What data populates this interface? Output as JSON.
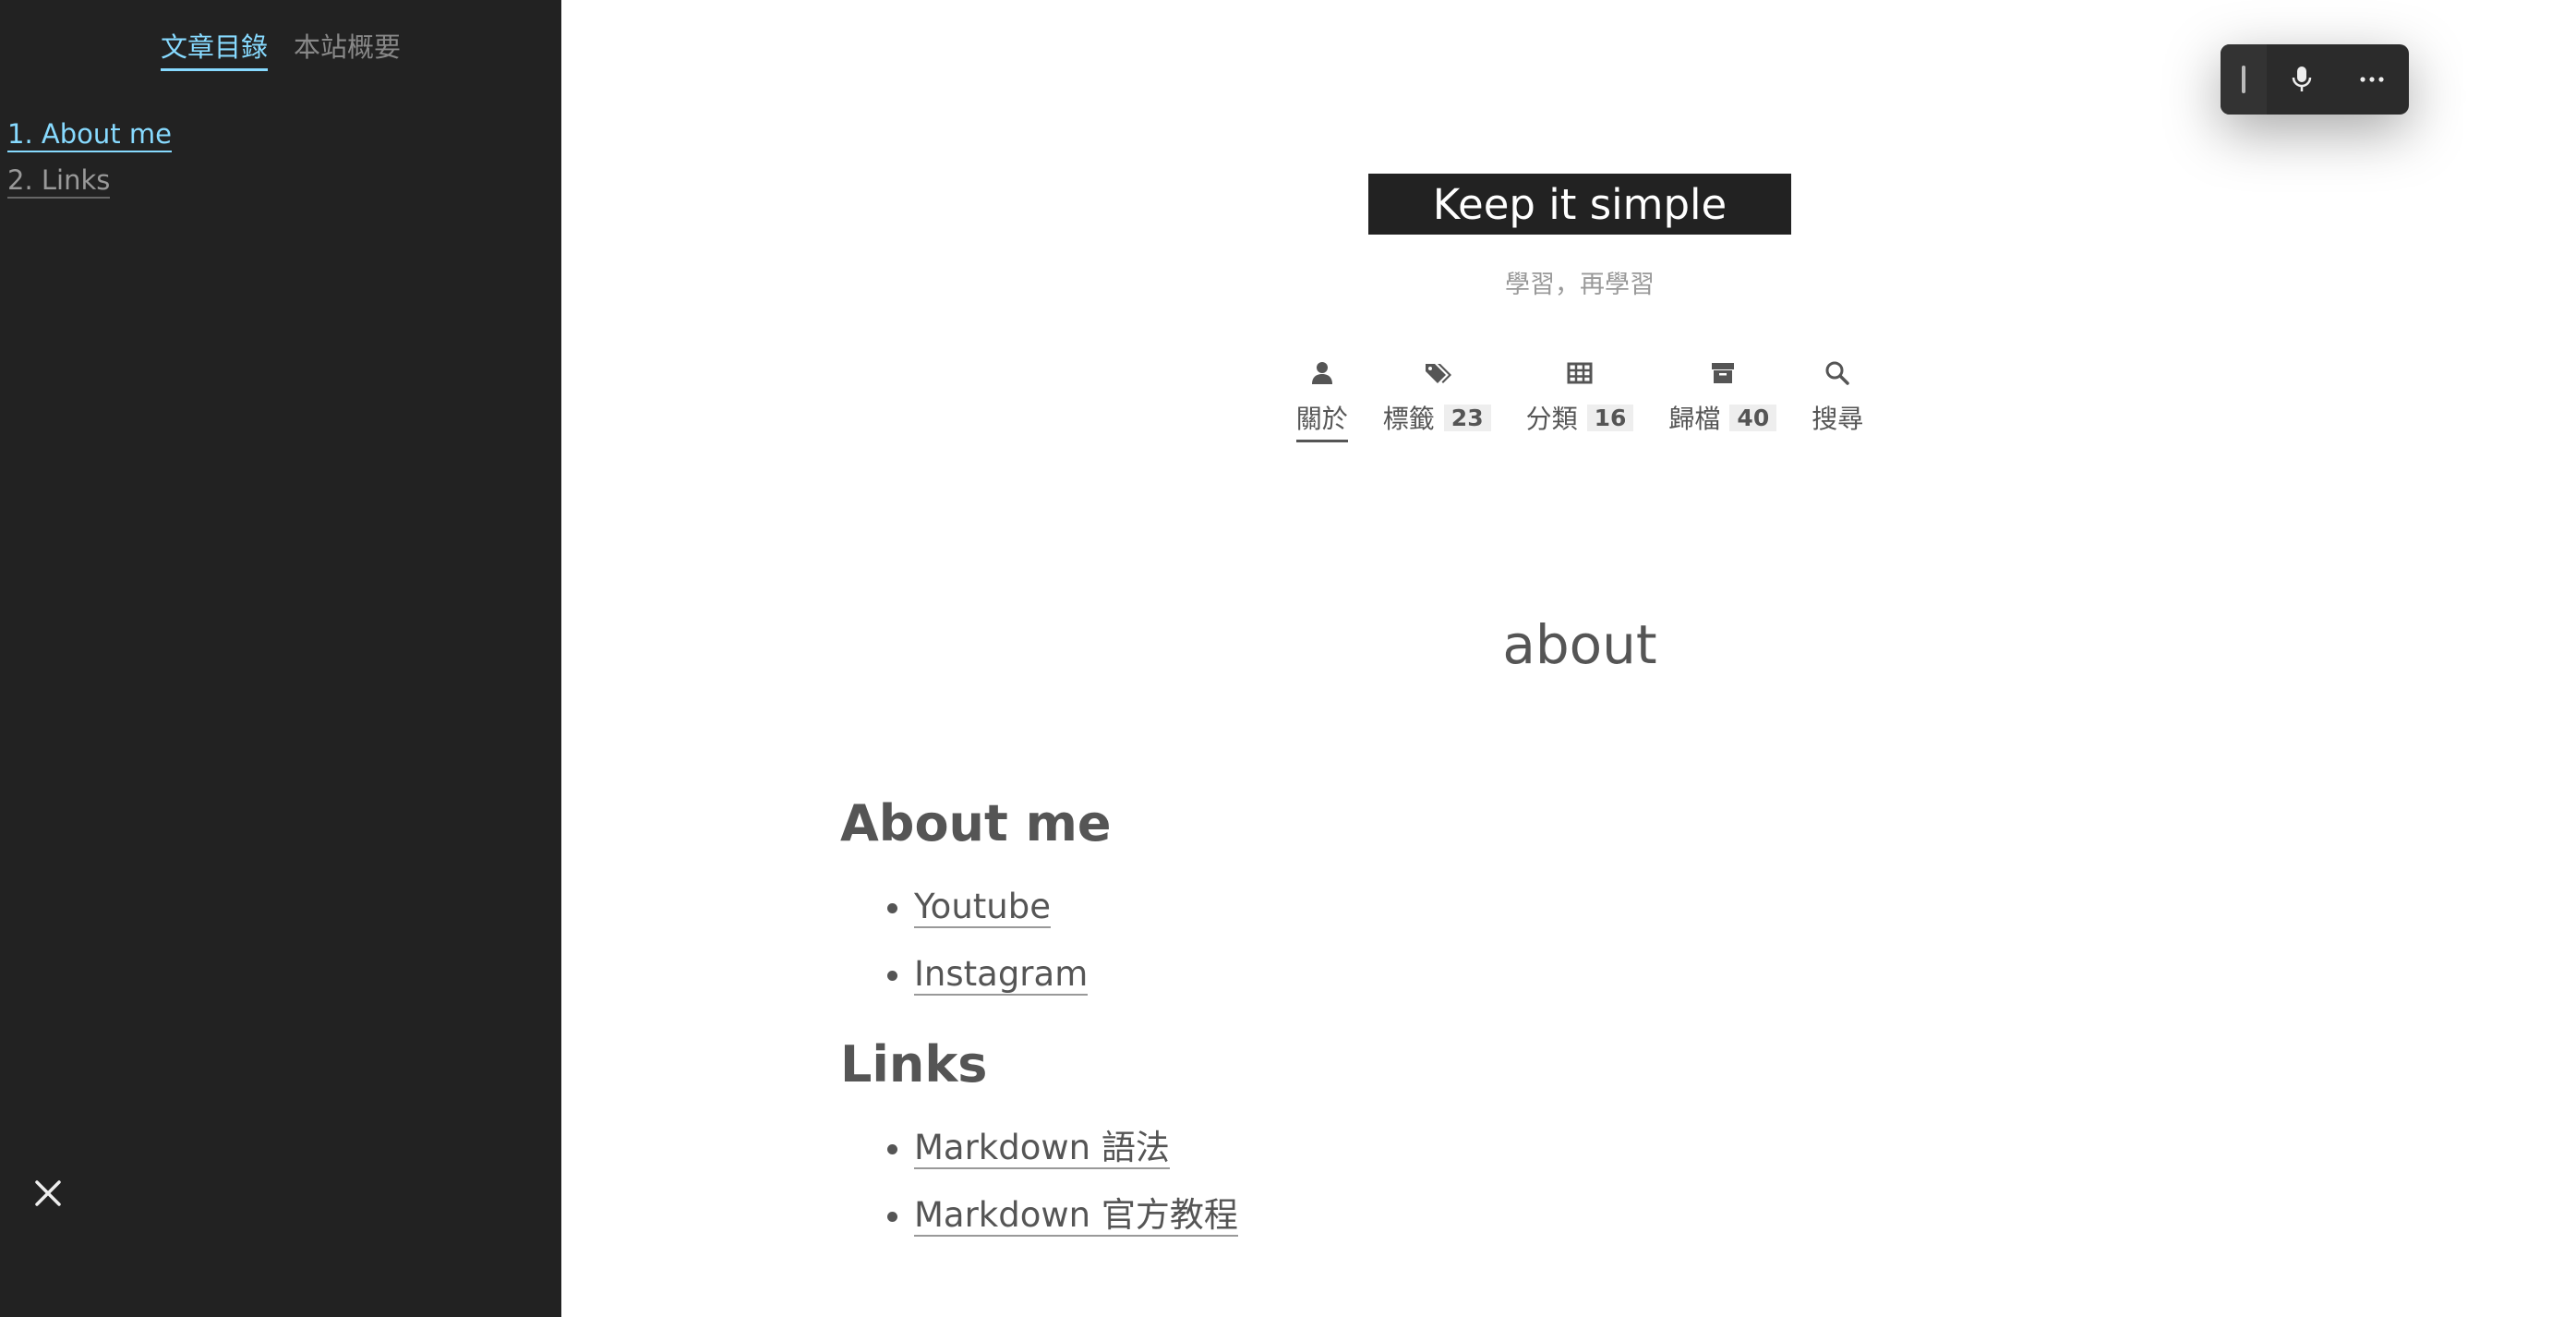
{
  "sidebar": {
    "tabs": [
      {
        "label": "文章目錄",
        "active": true
      },
      {
        "label": "本站概要",
        "active": false
      }
    ],
    "toc": [
      {
        "label": "1. About me",
        "active": true
      },
      {
        "label": "2. Links",
        "active": false
      }
    ],
    "close_icon": "close-icon"
  },
  "toolbar": {
    "icons": [
      "grip-icon",
      "microphone-icon",
      "more-icon"
    ]
  },
  "header": {
    "site_title": "Keep it simple",
    "subtitle": "學習，再學習",
    "menu": [
      {
        "label": "關於",
        "icon": "user-icon",
        "count": null,
        "active": true
      },
      {
        "label": "標籤",
        "icon": "tags-icon",
        "count": "23",
        "active": false
      },
      {
        "label": "分類",
        "icon": "grid-icon",
        "count": "16",
        "active": false
      },
      {
        "label": "歸檔",
        "icon": "archive-icon",
        "count": "40",
        "active": false
      },
      {
        "label": "搜尋",
        "icon": "search-icon",
        "count": null,
        "active": false
      }
    ]
  },
  "post": {
    "title": "about",
    "sections": [
      {
        "heading": "About me",
        "links": [
          "Youtube",
          "Instagram"
        ]
      },
      {
        "heading": "Links",
        "links": [
          "Markdown 語法",
          "Markdown 官方教程"
        ]
      }
    ]
  },
  "colors": {
    "sidebar_bg": "#222222",
    "accent": "#87daff",
    "text": "#555555"
  }
}
